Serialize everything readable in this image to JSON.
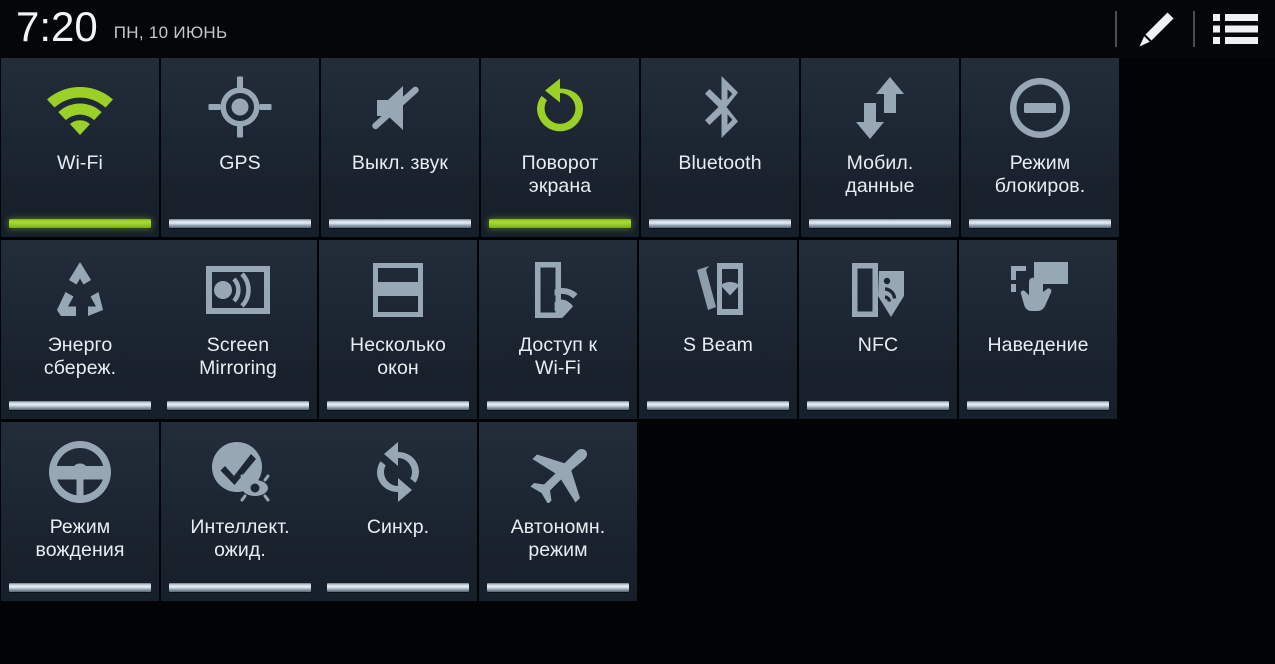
{
  "statusbar": {
    "time": "7:20",
    "date": "ПН, 10 ИЮНЬ",
    "edit_icon": "pencil-icon",
    "list_icon": "list-icon"
  },
  "colors": {
    "active_green": "#9ad028",
    "inactive_gray": "#98a7b4",
    "tile_bg": "#1d2733",
    "background": "#000000",
    "label_text": "#e8edf2"
  },
  "panel": {
    "columns": 8,
    "tiles": [
      {
        "id": "wifi",
        "label": "Wi-Fi",
        "lines": [
          "Wi-Fi"
        ],
        "icon": "wifi-icon",
        "state": "on"
      },
      {
        "id": "gps",
        "label": "GPS",
        "lines": [
          "GPS"
        ],
        "icon": "gps-icon",
        "state": "off"
      },
      {
        "id": "mute",
        "label": "Выкл. звук",
        "lines": [
          "Выкл. звук"
        ],
        "icon": "mute-icon",
        "state": "off"
      },
      {
        "id": "rotation",
        "label": "Поворот экрана",
        "lines": [
          "Поворот",
          "экрана"
        ],
        "icon": "screen-rotation-icon",
        "state": "on"
      },
      {
        "id": "bluetooth",
        "label": "Bluetooth",
        "lines": [
          "Bluetooth"
        ],
        "icon": "bluetooth-icon",
        "state": "off"
      },
      {
        "id": "mobiledata",
        "label": "Мобил. данные",
        "lines": [
          "Мобил.",
          "данные"
        ],
        "icon": "mobile-data-icon",
        "state": "off"
      },
      {
        "id": "blocking",
        "label": "Режим блокиров.",
        "lines": [
          "Режим",
          "блокиров."
        ],
        "icon": "blocking-mode-icon",
        "state": "off"
      },
      {
        "id": "powersave",
        "label": "Энерго сбереж.",
        "lines": [
          "Энерго",
          "сбереж."
        ],
        "icon": "power-saving-icon",
        "state": "off"
      },
      {
        "id": "mirroring",
        "label": "Screen Mirroring",
        "lines": [
          "Screen",
          "Mirroring"
        ],
        "icon": "screen-mirroring-icon",
        "state": "off"
      },
      {
        "id": "multiwindow",
        "label": "Несколько окон",
        "lines": [
          "Несколько",
          "окон"
        ],
        "icon": "multi-window-icon",
        "state": "off"
      },
      {
        "id": "hotspot",
        "label": "Доступ к Wi-Fi",
        "lines": [
          "Доступ к",
          "Wi-Fi"
        ],
        "icon": "wifi-hotspot-icon",
        "state": "off"
      },
      {
        "id": "sbeam",
        "label": "S Beam",
        "lines": [
          "S Beam"
        ],
        "icon": "s-beam-icon",
        "state": "off"
      },
      {
        "id": "nfc",
        "label": "NFC",
        "lines": [
          "NFC"
        ],
        "icon": "nfc-icon",
        "state": "off"
      },
      {
        "id": "airview",
        "label": "Наведение",
        "lines": [
          "Наведение"
        ],
        "icon": "air-view-icon",
        "state": "off"
      },
      {
        "id": "driving",
        "label": "Режим вождения",
        "lines": [
          "Режим",
          "вождения"
        ],
        "icon": "driving-mode-icon",
        "state": "off"
      },
      {
        "id": "smartstay",
        "label": "Интеллект. ожид.",
        "lines": [
          "Интеллект.",
          "ожид."
        ],
        "icon": "smart-stay-icon",
        "state": "off"
      },
      {
        "id": "sync",
        "label": "Синхр.",
        "lines": [
          "Синхр."
        ],
        "icon": "sync-icon",
        "state": "off"
      },
      {
        "id": "airplane",
        "label": "Автономн. режим",
        "lines": [
          "Автономн.",
          "режим"
        ],
        "icon": "airplane-mode-icon",
        "state": "off"
      }
    ]
  }
}
